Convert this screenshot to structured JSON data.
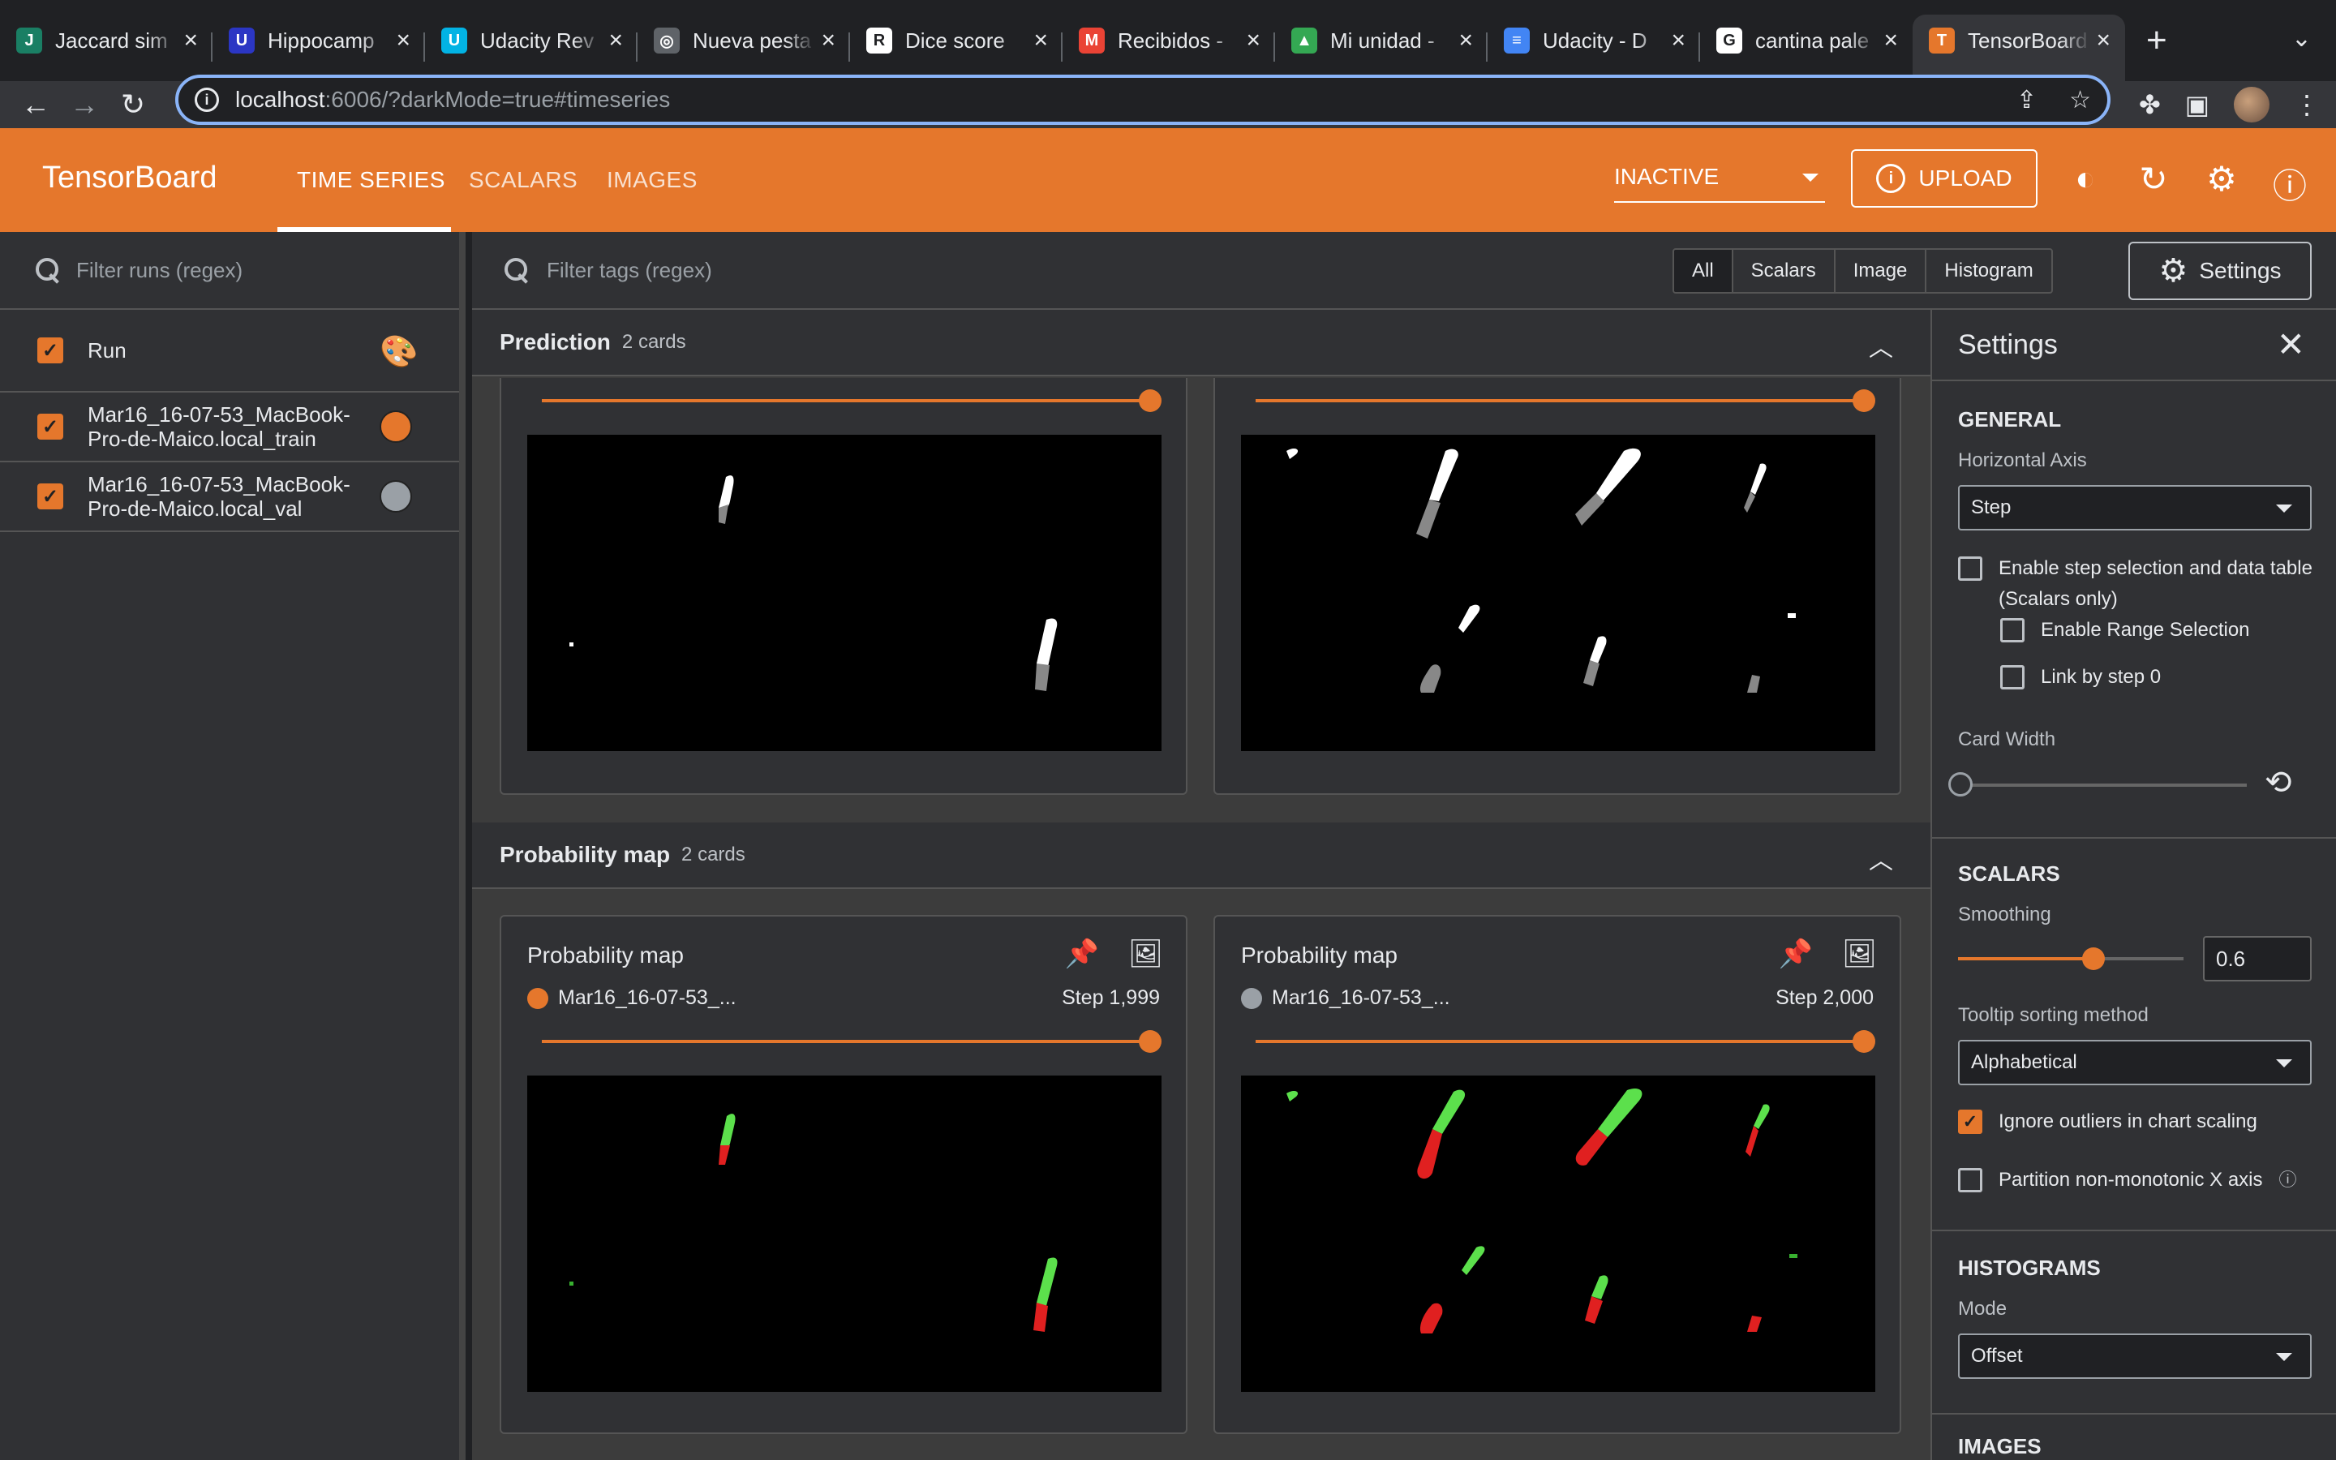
{
  "browser": {
    "tabs": [
      {
        "title": "Jaccard sim",
        "fav": "J",
        "color": "#1a7f64"
      },
      {
        "title": "Hippocamp",
        "fav": "U",
        "color": "#2b36c4"
      },
      {
        "title": "Udacity Rev",
        "fav": "U",
        "color": "#02b3e4"
      },
      {
        "title": "Nueva pesta",
        "fav": "◎",
        "color": "#5f6368"
      },
      {
        "title": "Dice score",
        "fav": "R",
        "color": "#ffffff"
      },
      {
        "title": "Recibidos -",
        "fav": "M",
        "color": "#ea4335"
      },
      {
        "title": "Mi unidad -",
        "fav": "▲",
        "color": "#34a853"
      },
      {
        "title": "Udacity - D",
        "fav": "≡",
        "color": "#4285f4"
      },
      {
        "title": "cantina pale",
        "fav": "G",
        "color": "#ffffff"
      },
      {
        "title": "TensorBoard",
        "fav": "T",
        "color": "#e5772c"
      }
    ],
    "url_host": "localhost",
    "url_rest": ":6006/?darkMode=true#timeseries"
  },
  "header": {
    "brand": "TensorBoard",
    "tabs": [
      "TIME SERIES",
      "SCALARS",
      "IMAGES"
    ],
    "status": "INACTIVE",
    "upload": "UPLOAD"
  },
  "sidebar": {
    "filter_placeholder": "Filter runs (regex)",
    "run_header": "Run",
    "runs": [
      {
        "line1": "Mar16_16-07-53_MacBook-",
        "line2": "Pro-de-Maico.local_train",
        "color": "#e5772c"
      },
      {
        "line1": "Mar16_16-07-53_MacBook-",
        "line2": "Pro-de-Maico.local_val",
        "color": "#9aa0a6"
      }
    ]
  },
  "main": {
    "filter_placeholder": "Filter tags (regex)",
    "type_filters": [
      "All",
      "Scalars",
      "Image",
      "Histogram"
    ],
    "settings_btn": "Settings",
    "sections": [
      {
        "title": "Prediction",
        "count": "2 cards"
      },
      {
        "title": "Probability map",
        "count": "2 cards"
      }
    ],
    "cards": [
      {
        "title": "Probability map",
        "run": "Mar16_16-07-53_...",
        "step": "Step 1,999",
        "dot": "#e5772c"
      },
      {
        "title": "Probability map",
        "run": "Mar16_16-07-53_...",
        "step": "Step 2,000",
        "dot": "#9aa0a6"
      }
    ]
  },
  "settings": {
    "title": "Settings",
    "general": "GENERAL",
    "horizontal_axis_label": "Horizontal Axis",
    "horizontal_axis_value": "Step",
    "enable_step_line1": "Enable step selection and data table",
    "enable_step_line2": "(Scalars only)",
    "enable_range": "Enable Range Selection",
    "link_by_step": "Link by step 0",
    "card_width": "Card Width",
    "scalars": "SCALARS",
    "smoothing_label": "Smoothing",
    "smoothing_value": "0.6",
    "smoothing_fraction": 0.6,
    "tooltip_label": "Tooltip sorting method",
    "tooltip_value": "Alphabetical",
    "ignore_outliers": "Ignore outliers in chart scaling",
    "partition": "Partition non-monotonic X axis",
    "histograms": "HISTOGRAMS",
    "mode_label": "Mode",
    "mode_value": "Offset",
    "images": "IMAGES"
  }
}
